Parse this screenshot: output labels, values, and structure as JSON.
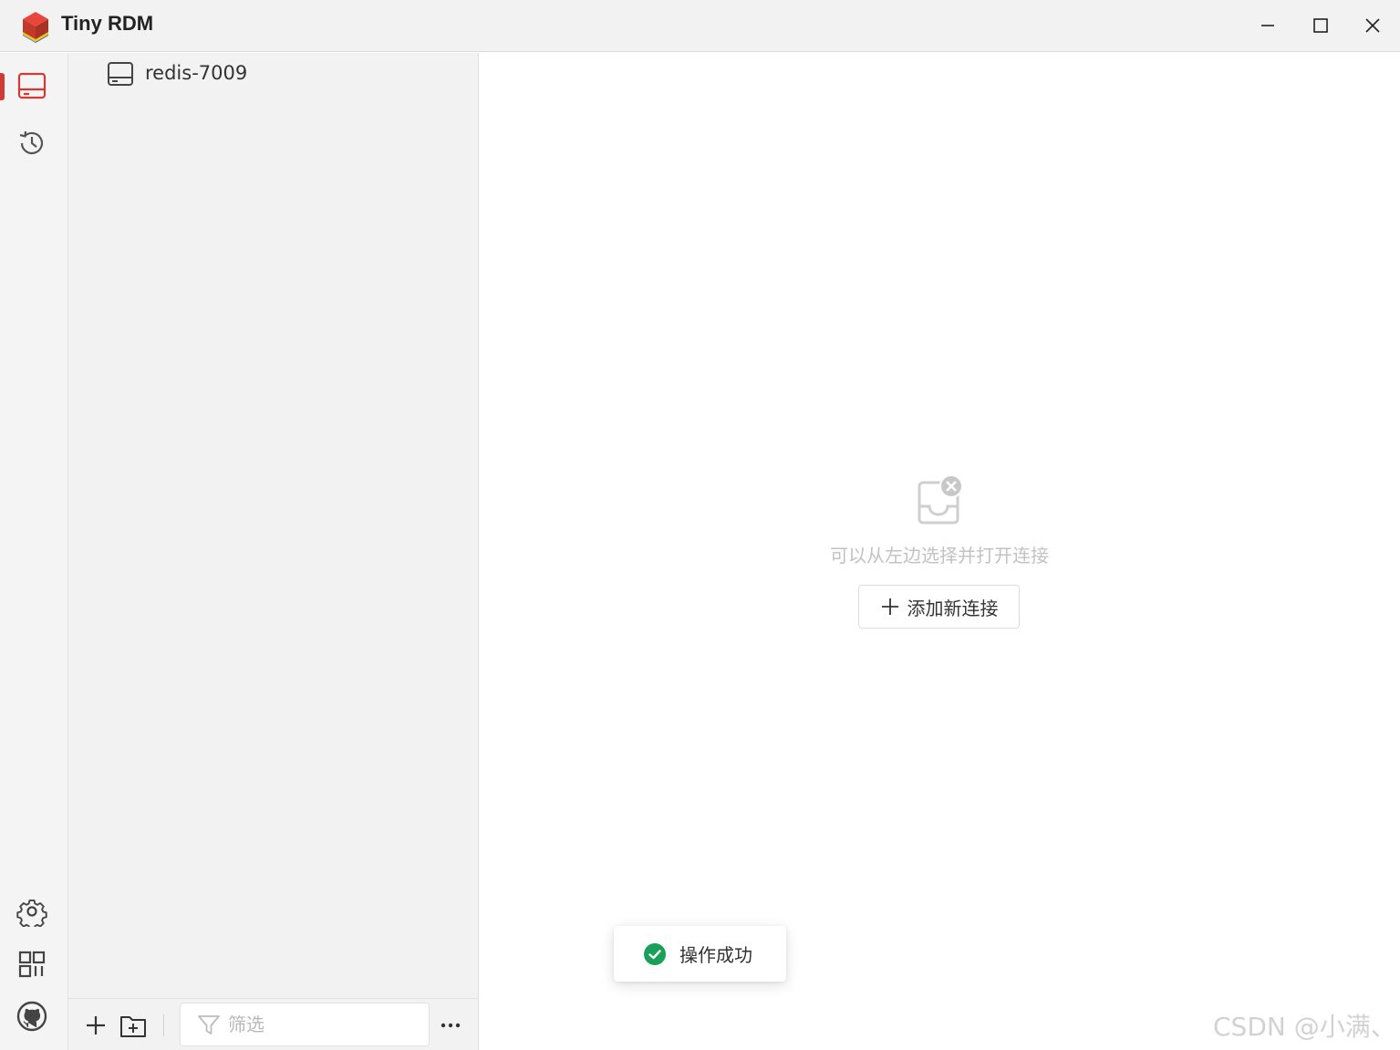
{
  "app": {
    "title": "Tiny RDM"
  },
  "window_controls": {
    "minimize": "minimize-icon",
    "maximize": "maximize-icon",
    "close": "close-icon"
  },
  "nav_rail": {
    "items": [
      {
        "icon": "server-icon",
        "active": true
      },
      {
        "icon": "history-icon",
        "active": false
      }
    ],
    "bottom_items": [
      {
        "icon": "gear-icon"
      },
      {
        "icon": "apps-icon"
      },
      {
        "icon": "github-icon"
      }
    ],
    "accent_color": "#d03b36"
  },
  "sidebar": {
    "connections": [
      {
        "label": "redis-7009",
        "icon": "server-icon"
      }
    ],
    "footer": {
      "add_icon": "plus-icon",
      "new_group_icon": "folder-plus-icon",
      "filter_placeholder": "筛选",
      "more_icon": "more-horizontal-icon"
    }
  },
  "main": {
    "empty_state": {
      "icon": "empty-inbox-icon",
      "message": "可以从左边选择并打开连接",
      "button_label": "添加新连接"
    }
  },
  "toast": {
    "message": "操作成功",
    "icon": "check-circle-icon",
    "color": "#18a058"
  },
  "watermark": "CSDN @小满、"
}
